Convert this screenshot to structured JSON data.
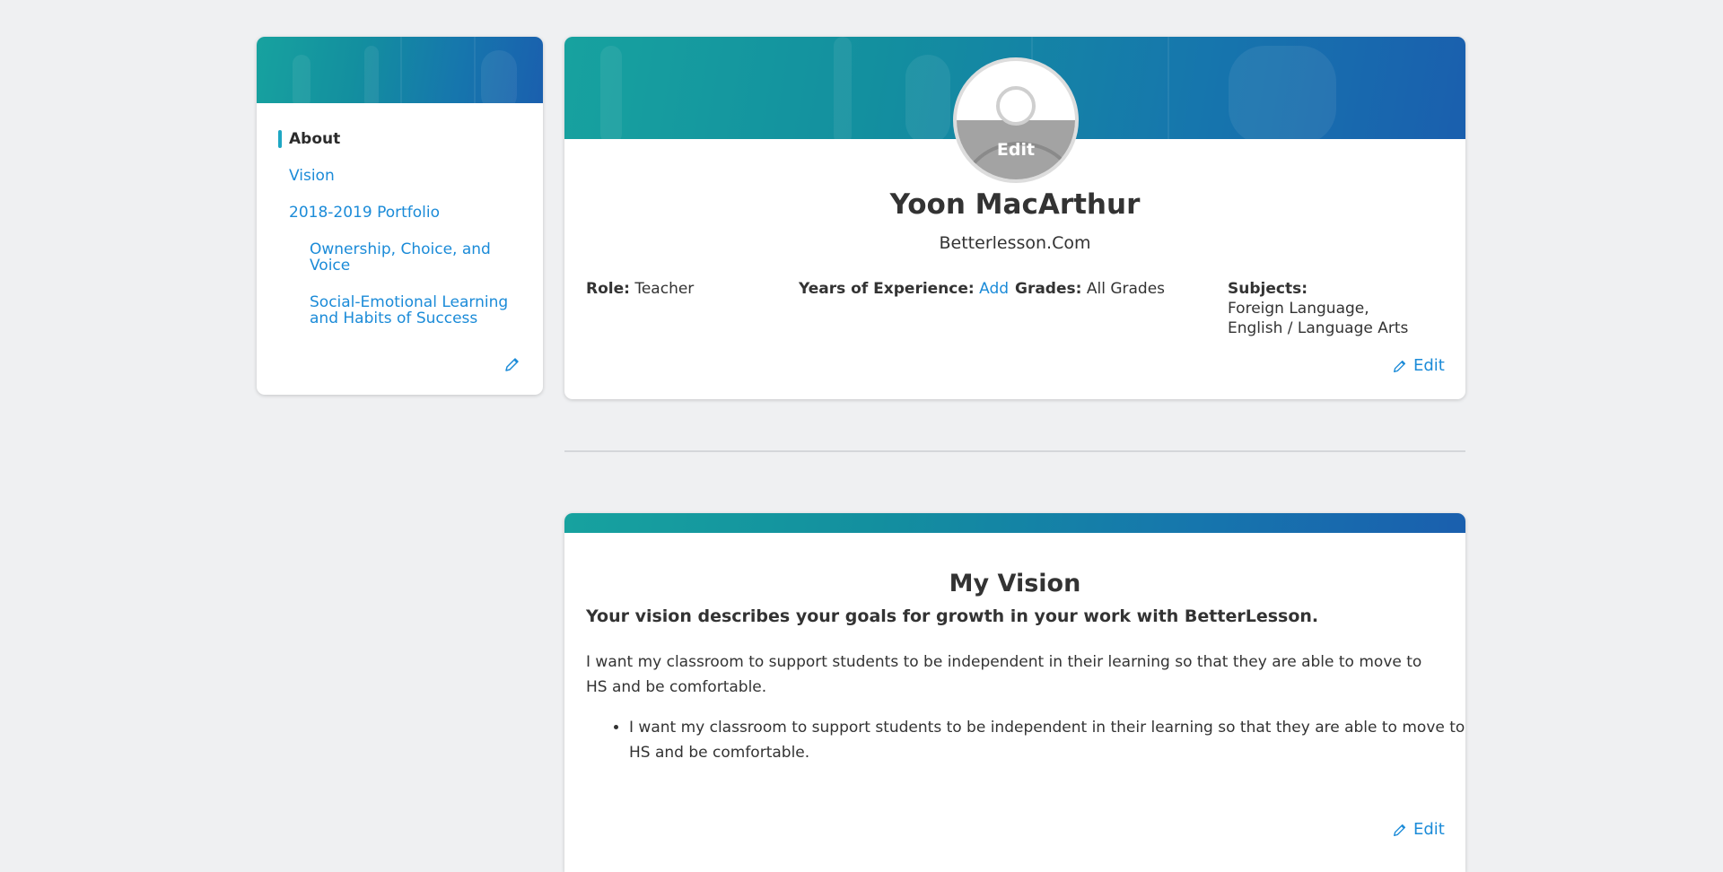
{
  "colors": {
    "accent_link": "#1b8bd8",
    "active_bar": "#1ea7c3",
    "banner_start": "#17a29f",
    "banner_end": "#1a5fae",
    "background": "#eff0f2"
  },
  "sidebar": {
    "items": [
      {
        "label": "About",
        "active": true
      },
      {
        "label": "Vision"
      },
      {
        "label": "2018-2019 Portfolio"
      },
      {
        "label": "Ownership, Choice, and Voice"
      },
      {
        "label": "Social-Emotional Learning and Habits of Success"
      }
    ],
    "edit_icon": "pencil-icon"
  },
  "profile": {
    "avatar_edit_label": "Edit",
    "name": "Yoon MacArthur",
    "organization": "Betterlesson.Com",
    "role_label": "Role:",
    "role_value": "Teacher",
    "experience_label": "Years of Experience:",
    "experience_action": "Add",
    "grades_label": "Grades:",
    "grades_value": "All Grades",
    "subjects_label": "Subjects:",
    "subjects_values": [
      "Foreign Language,",
      "English / Language Arts"
    ],
    "edit_label": "Edit"
  },
  "vision": {
    "title": "My Vision",
    "description": "Your vision describes your goals for growth in your work with BetterLesson.",
    "paragraph": "I want my classroom to support students to be independent in their learning so that they are able to move to HS and be comfortable.",
    "bullets": [
      "I want my classroom to support students to be independent in their learning so that they are able to move to HS and be comfortable."
    ],
    "edit_label": "Edit"
  }
}
